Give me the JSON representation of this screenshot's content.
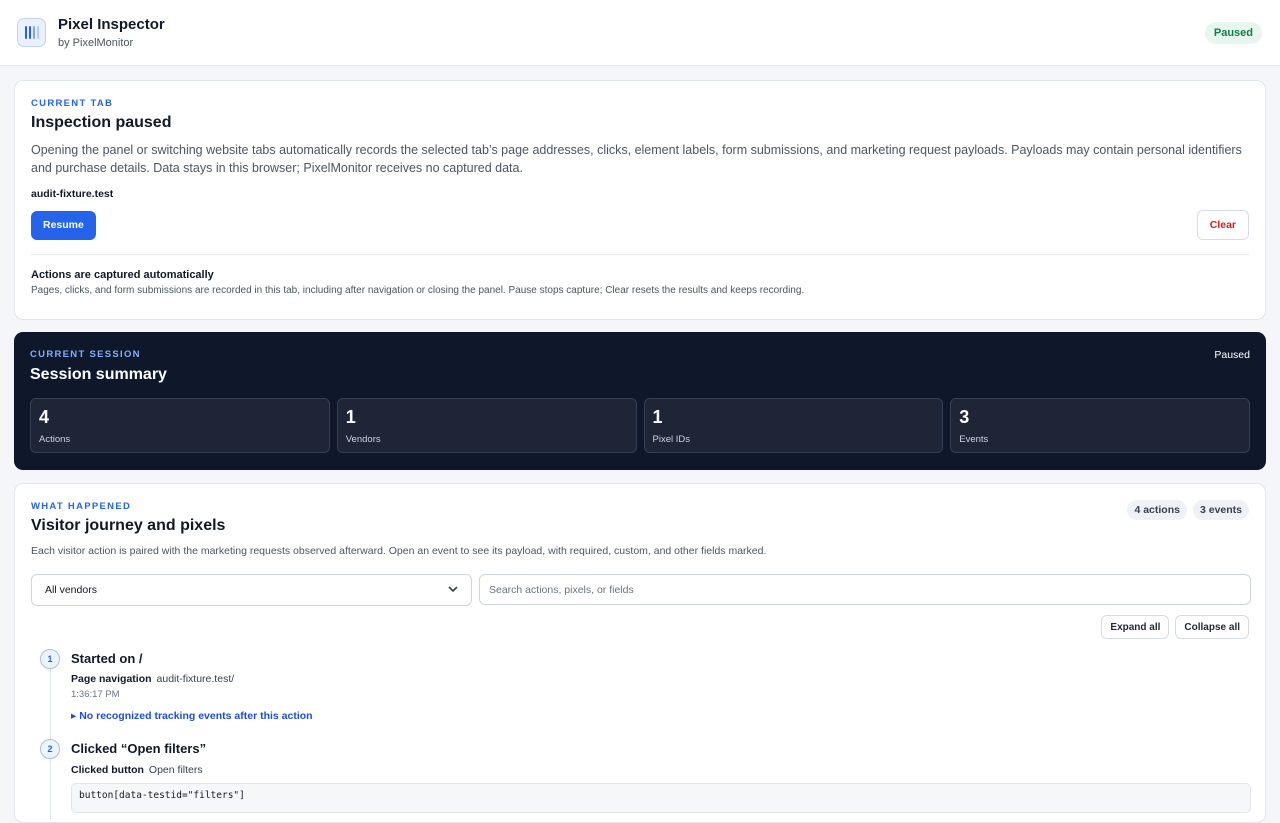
{
  "header": {
    "title": "Pixel Inspector",
    "subtitle": "by PixelMonitor",
    "status": "Paused",
    "logo_icon": "barcode-icon"
  },
  "current_tab": {
    "eyebrow": "CURRENT TAB",
    "title": "Inspection paused",
    "description": "Opening the panel or switching website tabs automatically records the selected tab’s page addresses, clicks, element labels, form submissions, and marketing request payloads. Payloads may contain personal identifiers and purchase details. Data stays in this browser; PixelMonitor receives no captured data.",
    "domain": "audit-fixture.test",
    "resume_label": "Resume",
    "clear_label": "Clear",
    "notice_title": "Actions are captured automatically",
    "notice_text": "Pages, clicks, and form submissions are recorded in this tab, including after navigation or closing the panel. Pause stops capture; Clear resets the results and keeps recording."
  },
  "session": {
    "eyebrow": "CURRENT SESSION",
    "title": "Session summary",
    "status": "Paused",
    "stats": [
      {
        "value": "4",
        "label": "Actions"
      },
      {
        "value": "1",
        "label": "Vendors"
      },
      {
        "value": "1",
        "label": "Pixel IDs"
      },
      {
        "value": "3",
        "label": "Events"
      }
    ]
  },
  "journey": {
    "eyebrow": "WHAT HAPPENED",
    "title": "Visitor journey and pixels",
    "actions_pill": "4 actions",
    "events_pill": "3 events",
    "description": "Each visitor action is paired with the marketing requests observed afterward. Open an event to see its payload, with required, custom, and other fields marked.",
    "vendor_filter": "All vendors",
    "search_placeholder": "Search actions, pixels, or fields",
    "expand_label": "Expand all",
    "collapse_label": "Collapse all",
    "steps": [
      {
        "number": "1",
        "title": "Started on /",
        "meta_label": "Page navigation",
        "meta_value": "audit-fixture.test/",
        "time": "1:36:17 PM",
        "link": "▸ No recognized tracking events after this action"
      },
      {
        "number": "2",
        "title": "Clicked “Open filters”",
        "meta_label": "Clicked button",
        "meta_value": "Open filters",
        "selector": "button[data-testid=\"filters\"]"
      }
    ]
  },
  "colors": {
    "accent": "#2563eb",
    "dark_panel": "#0f172a",
    "success": "#137d46",
    "danger": "#c81e1e"
  }
}
